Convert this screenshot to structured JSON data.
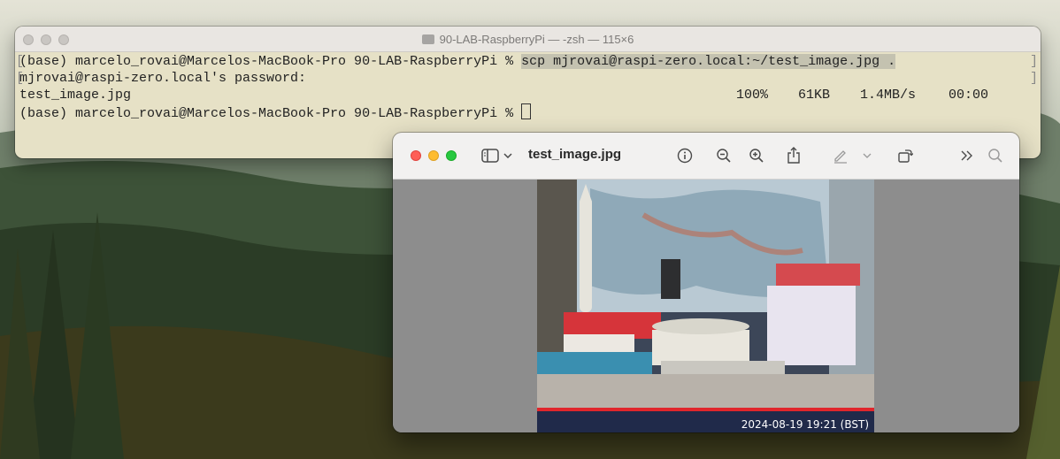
{
  "terminal": {
    "title": "90-LAB-RaspberryPi — -zsh — 115×6",
    "lines": [
      {
        "prompt": "(base) marcelo_rovai@Marcelos-MacBook-Pro 90-LAB-RaspberryPi % ",
        "command": "scp mjrovai@raspi-zero.local:~/test_image.jpg ."
      },
      {
        "text": "mjrovai@raspi-zero.local's password:"
      },
      {
        "file": "test_image.jpg",
        "percent": "100%",
        "size": "61KB",
        "rate": "1.4MB/s",
        "eta": "00:00"
      },
      {
        "prompt": "(base) marcelo_rovai@Marcelos-MacBook-Pro 90-LAB-RaspberryPi % "
      }
    ]
  },
  "preview": {
    "title": "test_image.jpg",
    "timestamp": "2024-08-19 19:21 (BST)",
    "icons": [
      "sidebar-icon",
      "chevron-down-icon",
      "info-icon",
      "zoom-out-icon",
      "zoom-in-icon",
      "share-icon",
      "markup-icon",
      "chevron-down-icon",
      "rotate-icon",
      "more-icon",
      "search-icon"
    ]
  },
  "colors": {
    "terminal_bg": "#e6e1c6",
    "selection": "#c4c2b0",
    "close": "#fe5f57",
    "minimize": "#febc2e",
    "zoom": "#28c840",
    "stamp_bar": "#e0262c"
  }
}
